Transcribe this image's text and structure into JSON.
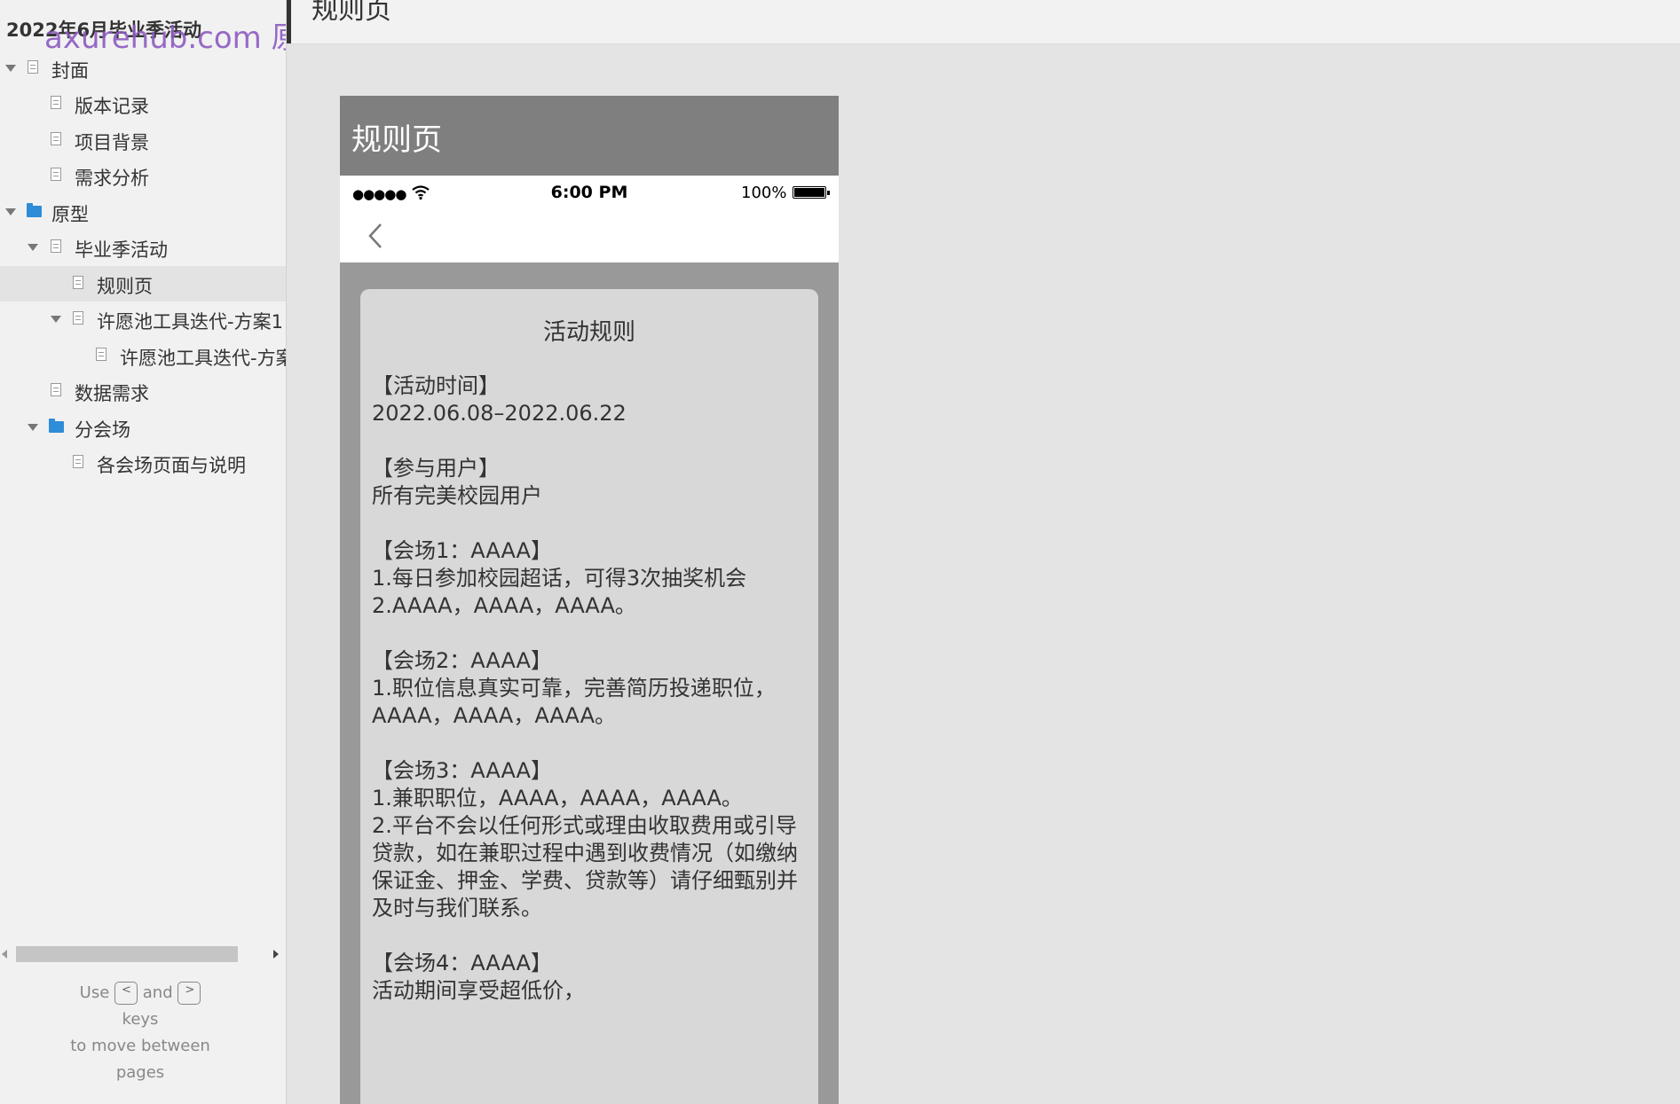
{
  "sidebar": {
    "project_title": "2022年6月毕业季活动",
    "watermark": "axurehub.com 原型资源站",
    "tree": [
      {
        "label": "封面",
        "icon": "page-icon",
        "expanded": true
      },
      {
        "label": "版本记录",
        "icon": "page-icon"
      },
      {
        "label": "项目背景",
        "icon": "page-icon"
      },
      {
        "label": "需求分析",
        "icon": "page-icon"
      },
      {
        "label": "原型",
        "icon": "folder-icon",
        "expanded": true
      },
      {
        "label": "毕业季活动",
        "icon": "page-icon",
        "expanded": true
      },
      {
        "label": "规则页",
        "icon": "page-icon",
        "selected": true
      },
      {
        "label": "许愿池工具迭代-方案1",
        "icon": "page-icon",
        "expanded": true
      },
      {
        "label": "许愿池工具迭代-方案",
        "icon": "page-icon"
      },
      {
        "label": "数据需求",
        "icon": "page-icon"
      },
      {
        "label": "分会场",
        "icon": "folder-icon",
        "expanded": true
      },
      {
        "label": "各会场页面与说明",
        "icon": "page-icon"
      }
    ],
    "hint": {
      "use": "Use",
      "key_prev": "<",
      "and": "and",
      "key_next": ">",
      "keys": "keys",
      "line3": "to move between",
      "line4": "pages"
    }
  },
  "topbar": {
    "page_name": "规则页"
  },
  "prototype": {
    "header_title": "规则页",
    "status_bar": {
      "signal": "●●●●●",
      "time": "6:00 PM",
      "battery": "100%"
    },
    "rules": {
      "title": "活动规则",
      "sections": [
        {
          "lines": [
            "【活动时间】",
            "2022.06.08–2022.06.22"
          ]
        },
        {
          "lines": [
            "【参与用户】",
            "所有完美校园用户"
          ]
        },
        {
          "lines": [
            "【会场1：AAAA】",
            "1.每日参加校园超话，可得3次抽奖机会",
            "2.AAAA，AAAA，AAAA。"
          ]
        },
        {
          "lines": [
            "【会场2：AAAA】",
            "1.职位信息真实可靠，完善简历投递职位，",
            "AAAA，AAAA，AAAA。"
          ]
        },
        {
          "lines": [
            "【会场3：AAAA】",
            "1.兼职职位，AAAA，AAAA，AAAA。",
            "2.平台不会以任何形式或理由收取费用或引导",
            "贷款，如在兼职过程中遇到收费情况（如缴纳",
            "保证金、押金、学费、贷款等）请仔细甄别并",
            "及时与我们联系。"
          ]
        },
        {
          "lines": [
            "【会场4：AAAA】",
            "活动期间享受超低价，"
          ]
        }
      ]
    }
  }
}
